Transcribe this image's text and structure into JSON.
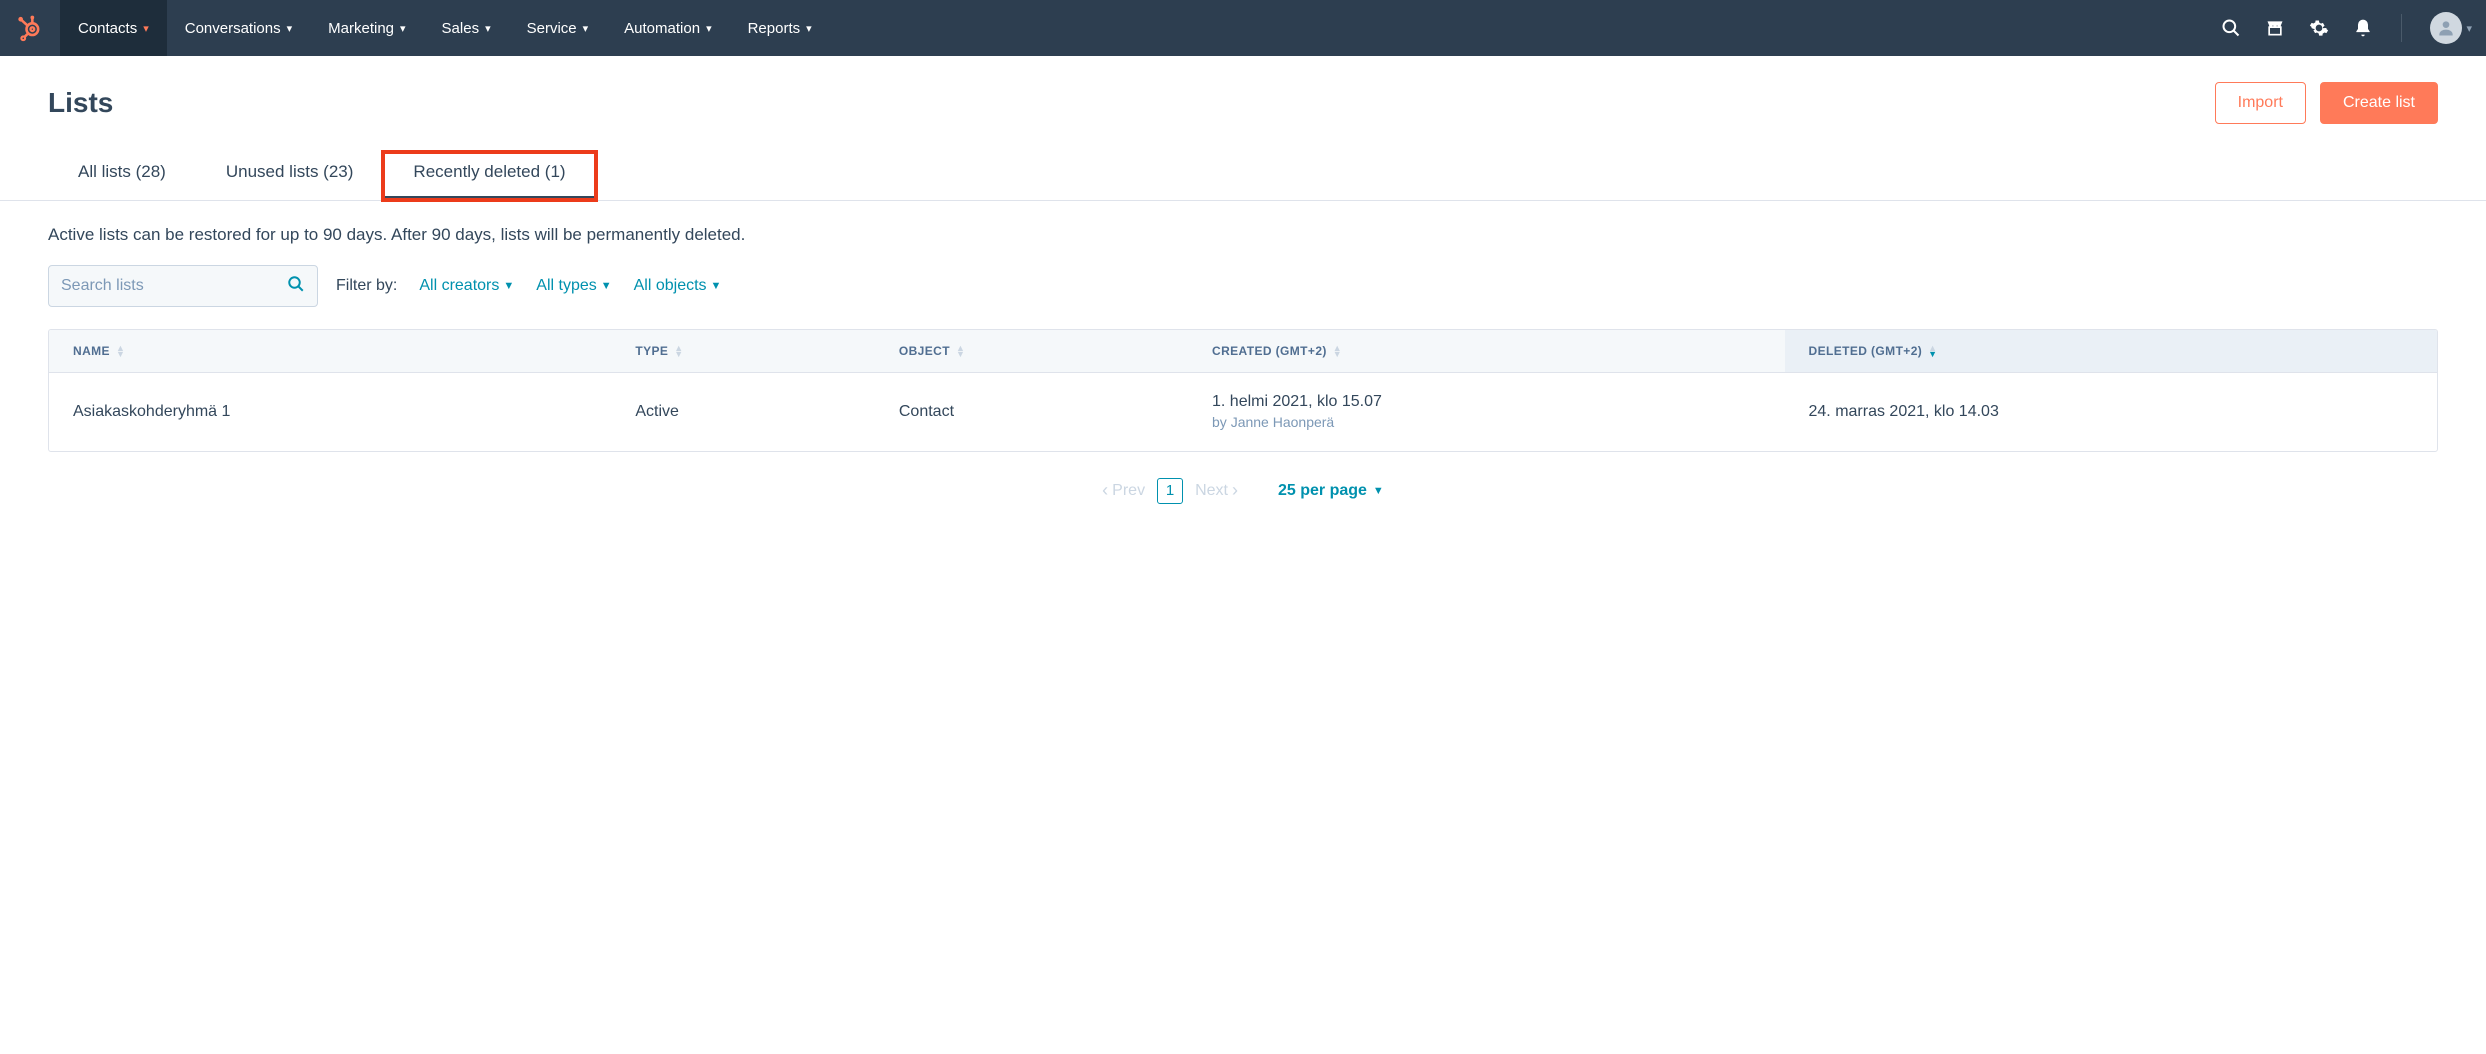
{
  "nav": {
    "items": [
      {
        "label": "Contacts",
        "active": true
      },
      {
        "label": "Conversations"
      },
      {
        "label": "Marketing"
      },
      {
        "label": "Sales"
      },
      {
        "label": "Service"
      },
      {
        "label": "Automation"
      },
      {
        "label": "Reports"
      }
    ]
  },
  "header": {
    "title": "Lists",
    "import_label": "Import",
    "create_label": "Create list"
  },
  "tabs": [
    {
      "label": "All lists (28)"
    },
    {
      "label": "Unused lists (23)"
    },
    {
      "label": "Recently deleted (1)",
      "active": true,
      "highlighted": true
    }
  ],
  "info_text": "Active lists can be restored for up to 90 days. After 90 days, lists will be permanently deleted.",
  "search": {
    "placeholder": "Search lists"
  },
  "filters": {
    "label": "Filter by:",
    "options": [
      "All creators",
      "All types",
      "All objects"
    ]
  },
  "table": {
    "columns": [
      {
        "label": "NAME"
      },
      {
        "label": "TYPE"
      },
      {
        "label": "OBJECT"
      },
      {
        "label": "CREATED (GMT+2)"
      },
      {
        "label": "DELETED (GMT+2)",
        "sorted": "desc"
      }
    ],
    "rows": [
      {
        "name": "Asiakaskohderyhmä 1",
        "type": "Active",
        "object": "Contact",
        "created": "1. helmi 2021, klo 15.07",
        "created_by": "by Janne Haonperä",
        "deleted": "24. marras 2021, klo 14.03"
      }
    ]
  },
  "pagination": {
    "prev": "Prev",
    "page": "1",
    "next": "Next",
    "per_page": "25 per page"
  }
}
